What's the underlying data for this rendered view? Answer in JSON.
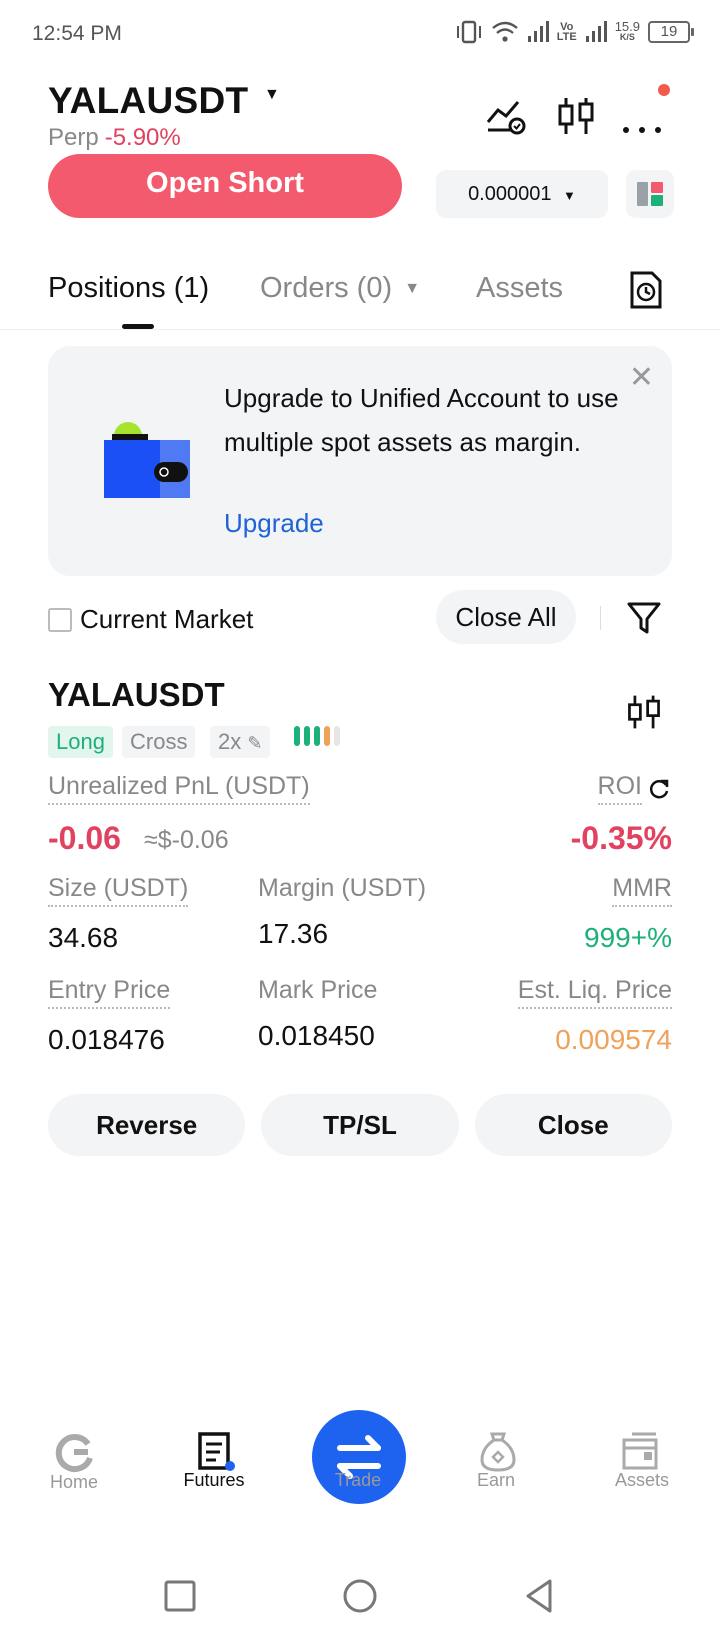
{
  "status_bar": {
    "time": "12:54 PM",
    "network_label": "Vo LTE",
    "speed": "15.9",
    "speed_unit": "K/S",
    "battery": "19"
  },
  "header": {
    "symbol": "YALAUSDT",
    "contract_type": "Perp",
    "change": "-5.90%"
  },
  "trade": {
    "open_short_label": "Open Short",
    "precision": "0.000001"
  },
  "tabs": [
    {
      "label": "Positions (1)"
    },
    {
      "label": "Orders (0)"
    },
    {
      "label": "Assets"
    }
  ],
  "banner": {
    "text": "Upgrade to Unified Account to use multiple spot assets as margin.",
    "link": "Upgrade"
  },
  "filter": {
    "current_market_label": "Current Market",
    "close_all_label": "Close All"
  },
  "position": {
    "symbol": "YALAUSDT",
    "side": "Long",
    "margin_mode": "Cross",
    "leverage": "2x",
    "unrealized_pnl_label": "Unrealized PnL (USDT)",
    "unrealized_pnl": "-0.06",
    "unrealized_pnl_usd": "≈$-0.06",
    "roi_label": "ROI",
    "roi": "-0.35%",
    "size_label": "Size (USDT)",
    "size": "34.68",
    "margin_label": "Margin (USDT)",
    "margin": "17.36",
    "mmr_label": "MMR",
    "mmr": "999+%",
    "entry_price_label": "Entry Price",
    "entry_price": "0.018476",
    "mark_price_label": "Mark Price",
    "mark_price": "0.018450",
    "liq_price_label": "Est. Liq. Price",
    "liq_price": "0.009574"
  },
  "actions": {
    "reverse": "Reverse",
    "tpsl": "TP/SL",
    "close": "Close"
  },
  "bottom_nav": [
    {
      "label": "Home"
    },
    {
      "label": "Futures"
    },
    {
      "label": "Trade"
    },
    {
      "label": "Earn"
    },
    {
      "label": "Assets"
    }
  ],
  "colors": {
    "short": "#f45a6d",
    "negative": "#e0425f",
    "positive": "#1db17a",
    "liq": "#f0a15a",
    "link": "#1e63d8",
    "fab": "#1e63f0"
  }
}
